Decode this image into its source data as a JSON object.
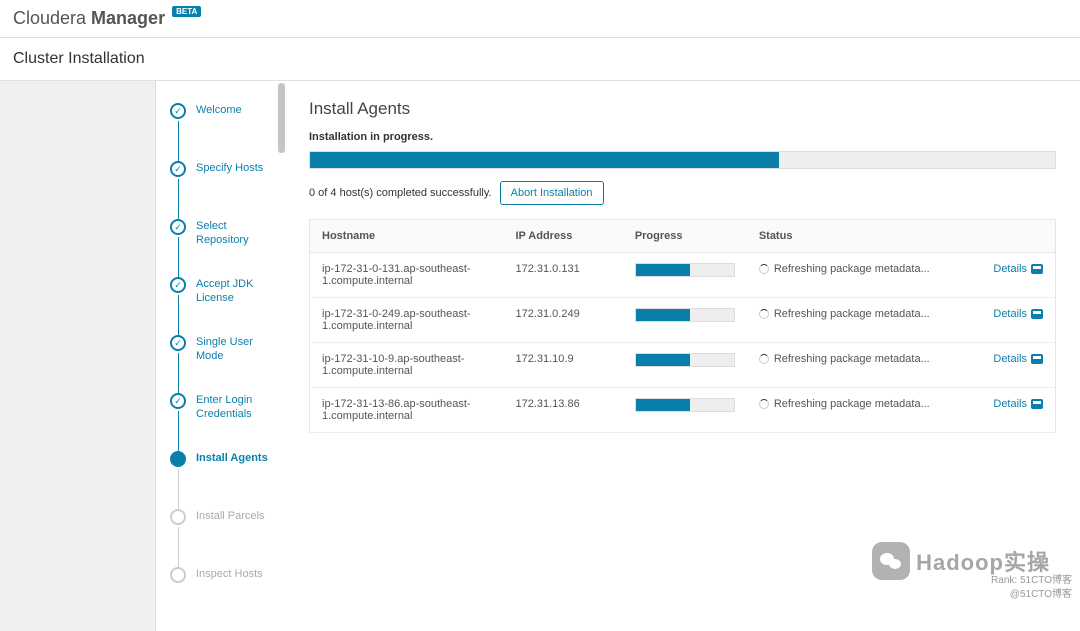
{
  "brand": {
    "light": "Cloudera ",
    "bold": "Manager",
    "badge": "BETA"
  },
  "subheader": "Cluster Installation",
  "stepper": [
    {
      "label": "Welcome",
      "state": "done"
    },
    {
      "label": "Specify Hosts",
      "state": "done"
    },
    {
      "label": "Select Repository",
      "state": "done"
    },
    {
      "label": "Accept JDK License",
      "state": "done"
    },
    {
      "label": "Single User Mode",
      "state": "done"
    },
    {
      "label": "Enter Login Credentials",
      "state": "done"
    },
    {
      "label": "Install Agents",
      "state": "current"
    },
    {
      "label": "Install Parcels",
      "state": "future"
    },
    {
      "label": "Inspect Hosts",
      "state": "future"
    }
  ],
  "page": {
    "title": "Install Agents",
    "progress_label": "Installation in progress.",
    "overall_progress_pct": 63,
    "summary": "0 of 4 host(s) completed successfully.",
    "abort_label": "Abort Installation"
  },
  "table": {
    "headers": {
      "hostname": "Hostname",
      "ip": "IP Address",
      "progress": "Progress",
      "status": "Status"
    },
    "details_label": "Details",
    "rows": [
      {
        "hostname": "ip-172-31-0-131.ap-southeast-1.compute.internal",
        "ip": "172.31.0.131",
        "progress_pct": 55,
        "status": "Refreshing package metadata..."
      },
      {
        "hostname": "ip-172-31-0-249.ap-southeast-1.compute.internal",
        "ip": "172.31.0.249",
        "progress_pct": 55,
        "status": "Refreshing package metadata..."
      },
      {
        "hostname": "ip-172-31-10-9.ap-southeast-1.compute.internal",
        "ip": "172.31.10.9",
        "progress_pct": 55,
        "status": "Refreshing package metadata..."
      },
      {
        "hostname": "ip-172-31-13-86.ap-southeast-1.compute.internal",
        "ip": "172.31.13.86",
        "progress_pct": 55,
        "status": "Refreshing package metadata..."
      }
    ]
  },
  "overlay": {
    "wechat_text": "Hadoop实操"
  },
  "watermark": {
    "line1": "Rank: 51CTO博客",
    "line2": "@51CTO博客"
  }
}
